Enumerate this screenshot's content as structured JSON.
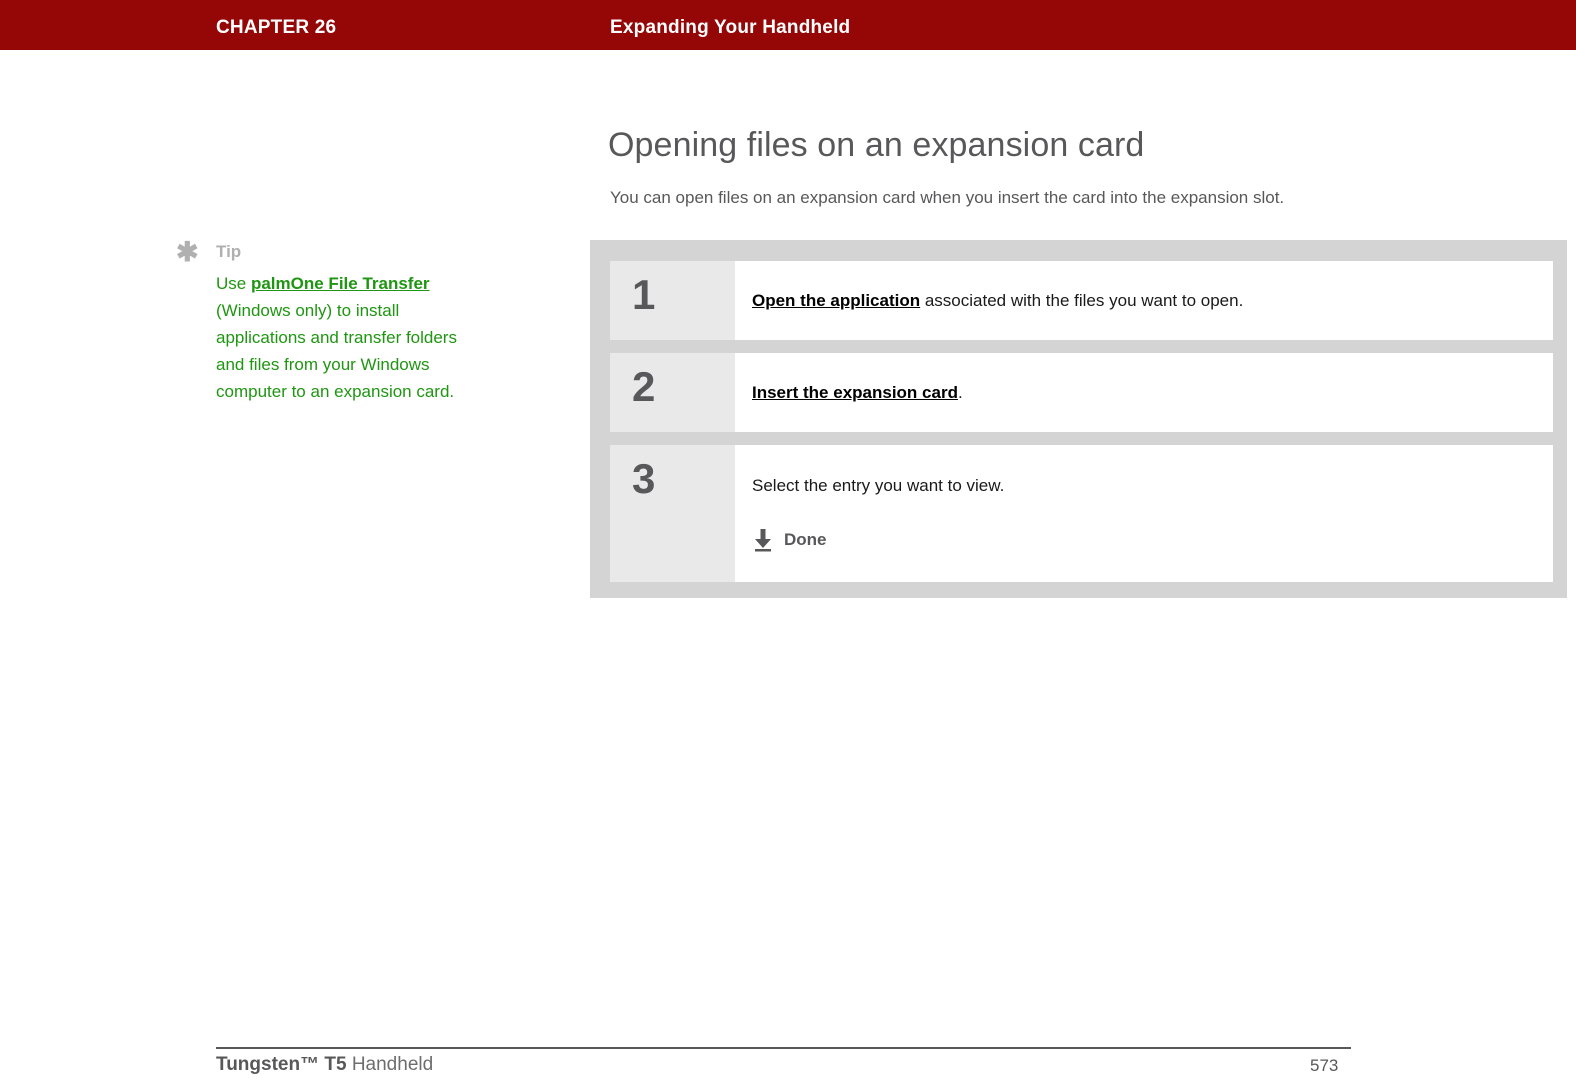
{
  "header": {
    "chapter": "CHAPTER 26",
    "title": "Expanding Your Handheld",
    "bar_color": "#950606"
  },
  "tip": {
    "icon": "asterisk-icon",
    "label": "Tip",
    "text_before_link": "Use ",
    "link_text": "palmOne File Transfer",
    "text_after_link": " (Windows only) to install applications and transfer folders and files from your Windows computer to an expansion card.",
    "link_color": "#1f9612"
  },
  "main": {
    "heading": "Opening files on an expansion card",
    "intro": "You can open files on an expansion card when you insert the card into the expansion slot.",
    "steps": [
      {
        "number": "1",
        "link_text": "Open the application",
        "rest_text": " associated with the files you want to open."
      },
      {
        "number": "2",
        "link_text": "Insert the expansion card",
        "rest_text": "."
      },
      {
        "number": "3",
        "plain_text": "Select the entry you want to view.",
        "done_icon": "download-arrow-icon",
        "done_label": "Done"
      }
    ]
  },
  "footer": {
    "product": "Tungsten™ T5",
    "suffix": " Handheld",
    "page_number": "573"
  }
}
